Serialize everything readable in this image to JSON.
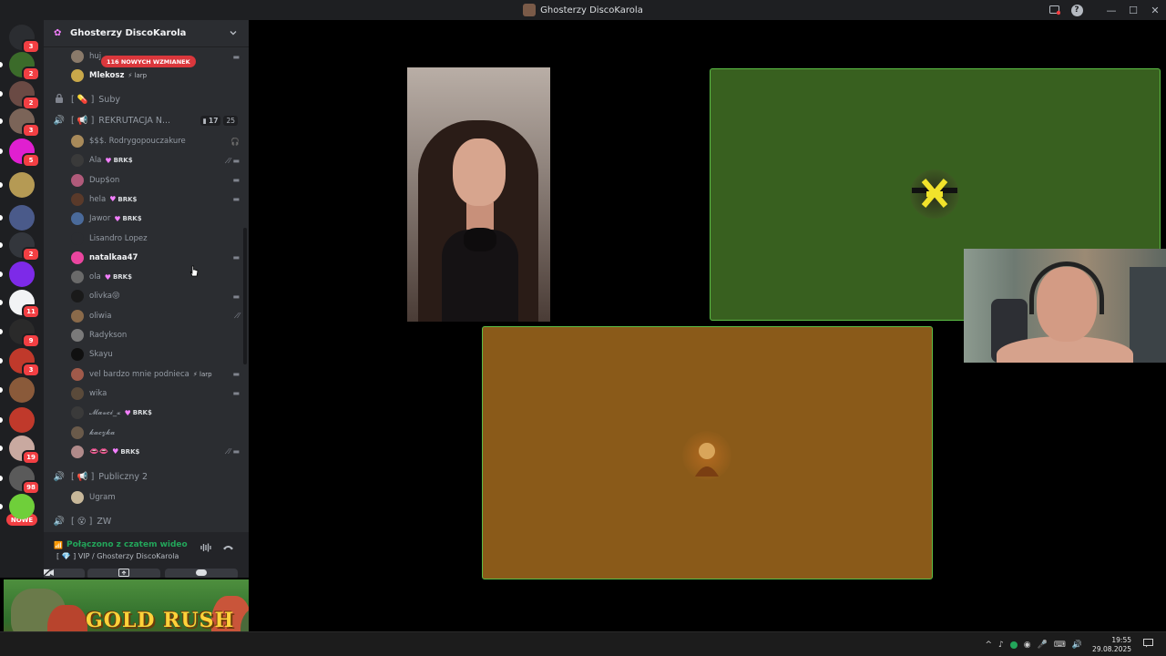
{
  "window": {
    "title": "Ghosterzy DiscoKarola",
    "minimize": "—",
    "maximize": "☐",
    "close": "✕",
    "help": "?"
  },
  "rail": {
    "servers": [
      {
        "badge": "3",
        "color": "#2b2d31",
        "icon": "discord-icon"
      },
      {
        "badge": "2",
        "color": "#3b6b2a"
      },
      {
        "badge": "2",
        "color": "#6a4a44"
      },
      {
        "badge": "3",
        "color": "#7b6458"
      },
      {
        "badge": "5",
        "color": "#e01fd0"
      },
      {
        "badge": "",
        "color": "#b59a54"
      },
      {
        "badge": "",
        "color": "#4a5a8a"
      },
      {
        "badge": "2",
        "color": "#33363c"
      },
      {
        "badge": "",
        "color": "#7d2ae8"
      },
      {
        "badge": "11",
        "color": "#f2f3f5"
      },
      {
        "badge": "9",
        "color": "#2a2a2a"
      },
      {
        "badge": "3",
        "color": "#c0392b"
      },
      {
        "badge": "",
        "color": "#8a5a3a"
      },
      {
        "badge": "",
        "color": "#c0392b"
      },
      {
        "badge": "19",
        "color": "#c9a9a0"
      },
      {
        "badge": "98",
        "color": "#5a5a5a"
      },
      {
        "badge": "",
        "color": "#6fcf3a"
      }
    ],
    "nowe_label": "NOWE"
  },
  "sidebar": {
    "server_name": "Ghosterzy DiscoKarola",
    "mention_pill": "116 NOWYCH WZMIANEK",
    "top_users": [
      {
        "name": "huj",
        "tag": "",
        "right": "cam"
      },
      {
        "name": "Mlekosz",
        "tag": "⚡ larp",
        "right": ""
      }
    ],
    "channels": {
      "suby": "Suby",
      "suby_prefix": "[ 💊 ]",
      "rekrutacja": "REKRUTACJA N...",
      "rekrutacja_prefix": "[ 📢 ]",
      "rekrutacja_video": "17",
      "rekrutacja_count": "25",
      "publiczny": "Publiczny 2",
      "publiczny_prefix": "[ 📢 ]",
      "zw": "ZW",
      "zw_prefix": "[ 😵 ]"
    },
    "voice_users": [
      {
        "name": "$$$. Rodrygopouczakure",
        "tag": "",
        "right": "deaf-red",
        "color": "#a88a5a",
        "bright": false
      },
      {
        "name": "Ala",
        "tag": "BRK$",
        "right": "mute-cam",
        "color": "#3a3a3a",
        "bright": false
      },
      {
        "name": "Dup$on",
        "tag": "",
        "right": "cam",
        "color": "#b05a7a",
        "bright": false
      },
      {
        "name": "hela",
        "tag": "BRK$",
        "right": "cam",
        "color": "#5a3a2a",
        "bright": false
      },
      {
        "name": "Jawor",
        "tag": "BRK$",
        "right": "",
        "color": "#4a6a9a",
        "bright": false
      },
      {
        "name": "Lisandro Lopez",
        "tag": "",
        "right": "",
        "color": "#2b2d31",
        "bright": false
      },
      {
        "name": "natalkaa47",
        "tag": "",
        "right": "cam",
        "color": "#eb459f",
        "bright": true
      },
      {
        "name": "ola",
        "tag": "BRK$",
        "right": "",
        "color": "#6a6a6a",
        "bright": false
      },
      {
        "name": "olivka😝",
        "tag": "",
        "right": "cam",
        "color": "#1a1a1a",
        "bright": false
      },
      {
        "name": "oliwia",
        "tag": "",
        "right": "mute",
        "color": "#8a6a4a",
        "bright": false
      },
      {
        "name": "Radykson",
        "tag": "",
        "right": "",
        "color": "#7a7a7a",
        "bright": false
      },
      {
        "name": "Skayu",
        "tag": "",
        "right": "",
        "color": "#101010",
        "bright": false
      },
      {
        "name": "vel bardzo mnie podnieca",
        "tag": "⚡ larp",
        "right": "cam",
        "color": "#a05a4a",
        "bright": false
      },
      {
        "name": "wika",
        "tag": "",
        "right": "cam",
        "color": "#5a4a3a",
        "bright": false
      },
      {
        "name": "𝓜𝓪𝓿𝓬𝓲_𝔁",
        "tag": "BRK$",
        "right": "",
        "color": "#3a3a3a",
        "bright": false
      },
      {
        "name": "𝓴𝓪𝓬𝔃𝓴𝓪",
        "tag": "",
        "right": "",
        "color": "#6a5a4a",
        "bright": false
      },
      {
        "name": "👄👄",
        "tag": "BRK$",
        "right": "mute-cam",
        "color": "#b08a8a",
        "bright": false
      }
    ],
    "publiczny_users": [
      {
        "name": "Ugram",
        "color": "#c8b89a"
      }
    ]
  },
  "voice_panel": {
    "status": "Połączono z czatem wideo",
    "location": "[ 💎 ] VIP / Ghosterzy DiscoKarola"
  },
  "ad": {
    "title": "GOLD RUSH"
  },
  "stage": {
    "green_tile_color": "#38601f",
    "orange_tile_color": "#8a5a19",
    "speaking_border": "#5bbd45"
  },
  "taskbar": {
    "time": "19:55",
    "date": "29.08.2025"
  }
}
